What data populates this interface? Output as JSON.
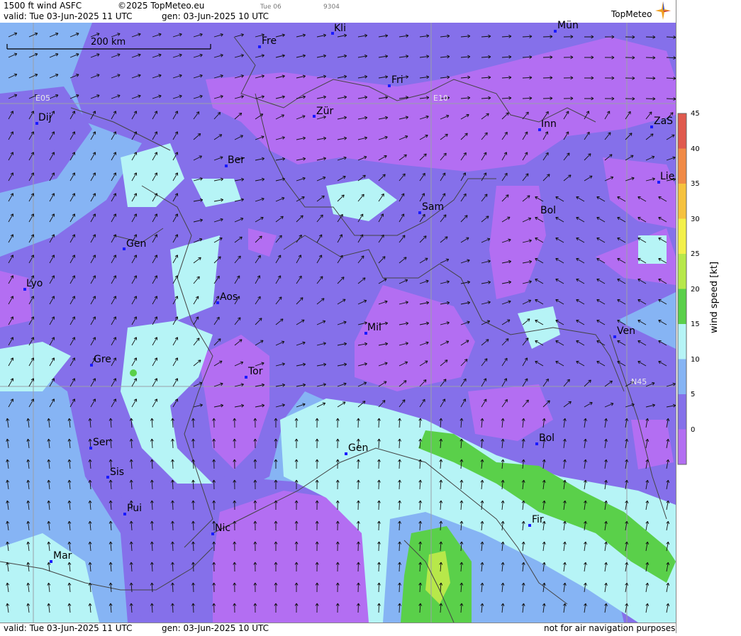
{
  "header": {
    "product": "1500 ft wind ASFC",
    "copyright": "©2025 TopMeteo.eu",
    "day": "Tue 06",
    "code": "9304",
    "valid": "valid:  Tue  03-Jun-2025  11 UTC",
    "generated": "gen: 03-Jun-2025 10 UTC",
    "logo": "TopMeteo"
  },
  "footer": {
    "valid": "valid:  Tue  03-Jun-2025  11 UTC",
    "generated": "gen: 03-Jun-2025 10 UTC",
    "disclaimer": "not for air navigation purposes"
  },
  "scalebar": {
    "label": "200 km"
  },
  "grid_labels": {
    "e05": "E05",
    "e10": "E10",
    "n45": "N45"
  },
  "legend": {
    "title": "wind speed [kt]",
    "ticks": [
      "45",
      "40",
      "35",
      "30",
      "25",
      "20",
      "15",
      "10",
      "5",
      "0"
    ],
    "colors": [
      "#e05a4e",
      "#f08a46",
      "#f6c23e",
      "#f3f04a",
      "#b7e84a",
      "#5ad04a",
      "#b6f4f6",
      "#86b4f4",
      "#8570ea",
      "#b36ef2"
    ]
  },
  "cities": [
    {
      "name": "Kli"
    },
    {
      "name": "Fre"
    },
    {
      "name": "Mün"
    },
    {
      "name": "Fri"
    },
    {
      "name": "Dij"
    },
    {
      "name": "Zür"
    },
    {
      "name": "Inn"
    },
    {
      "name": "ZaS"
    },
    {
      "name": "Ber"
    },
    {
      "name": "Lie"
    },
    {
      "name": "Sam"
    },
    {
      "name": "Bol"
    },
    {
      "name": "Gen"
    },
    {
      "name": "Lyo"
    },
    {
      "name": "Aos"
    },
    {
      "name": "Mil"
    },
    {
      "name": "Ven"
    },
    {
      "name": "Gre"
    },
    {
      "name": "Tor"
    },
    {
      "name": "Ser"
    },
    {
      "name": "Gen"
    },
    {
      "name": "Bol"
    },
    {
      "name": "Sis"
    },
    {
      "name": "Pui"
    },
    {
      "name": "Nic"
    },
    {
      "name": "Fir"
    },
    {
      "name": "Mar"
    }
  ]
}
